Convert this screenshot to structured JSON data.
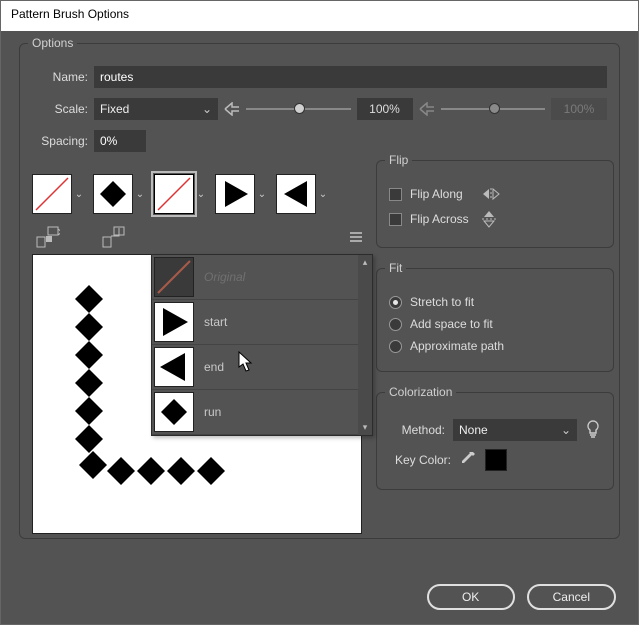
{
  "title": "Pattern Brush Options",
  "options": {
    "group_label": "Options",
    "name_label": "Name:",
    "name_value": "routes",
    "scale_label": "Scale:",
    "scale_mode": "Fixed",
    "scale_value": "100%",
    "scale_value2": "100%",
    "spacing_label": "Spacing:",
    "spacing_value": "0%"
  },
  "dropdown": {
    "items": [
      {
        "label": "Original",
        "kind": "original"
      },
      {
        "label": "start",
        "kind": "start"
      },
      {
        "label": "end",
        "kind": "end"
      },
      {
        "label": "run",
        "kind": "run"
      }
    ]
  },
  "flip": {
    "group_label": "Flip",
    "along_label": "Flip Along",
    "across_label": "Flip Across"
  },
  "fit": {
    "group_label": "Fit",
    "stretch_label": "Stretch to fit",
    "add_space_label": "Add space to fit",
    "approx_label": "Approximate path"
  },
  "colorization": {
    "group_label": "Colorization",
    "method_label": "Method:",
    "method_value": "None",
    "key_color_label": "Key Color:",
    "key_color": "#000000"
  },
  "buttons": {
    "ok": "OK",
    "cancel": "Cancel"
  }
}
